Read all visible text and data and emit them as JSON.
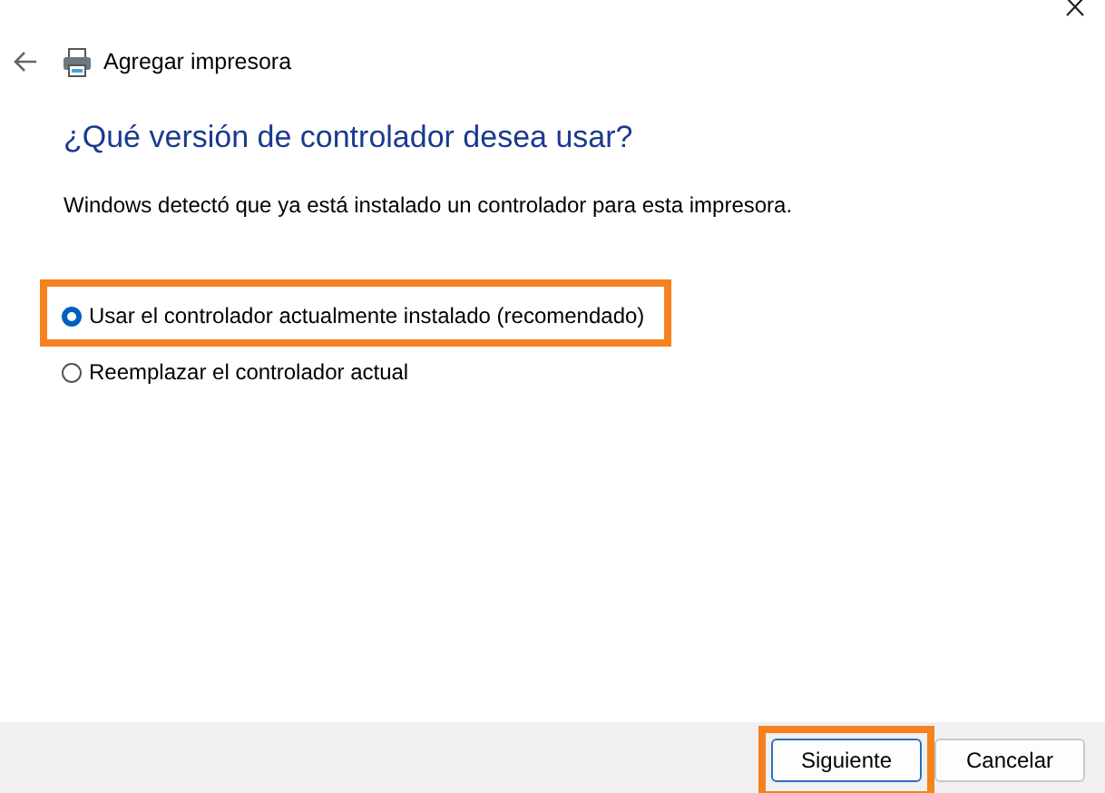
{
  "window": {
    "title": "Agregar impresora"
  },
  "heading": "¿Qué versión de controlador desea usar?",
  "description": "Windows detectó que ya está instalado un controlador para esta impresora.",
  "options": [
    {
      "label": "Usar el controlador actualmente instalado (recomendado)",
      "selected": true,
      "highlighted": true
    },
    {
      "label": "Reemplazar el controlador actual",
      "selected": false,
      "highlighted": false
    }
  ],
  "buttons": [
    {
      "label": "Siguiente",
      "default": true,
      "highlighted": true
    },
    {
      "label": "Cancelar",
      "default": false,
      "highlighted": false
    }
  ]
}
